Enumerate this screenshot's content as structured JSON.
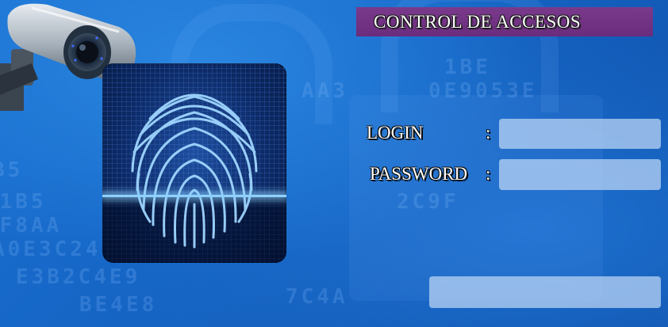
{
  "header": {
    "title": "CONTROL DE ACCESOS"
  },
  "form": {
    "login_label": "LOGIN",
    "login_separator": ":",
    "password_label": "PASSWORD",
    "password_separator": ":",
    "login_value": "",
    "password_value": ""
  },
  "submit": {
    "label": ""
  },
  "icons": {
    "camera": "security-camera-icon",
    "fingerprint": "fingerprint-icon"
  },
  "colors": {
    "background": "#1666c4",
    "title_bar": "#6a2c7c",
    "field_fill": "#bed7f5",
    "fingerprint_glow": "#8fd0ff"
  }
}
